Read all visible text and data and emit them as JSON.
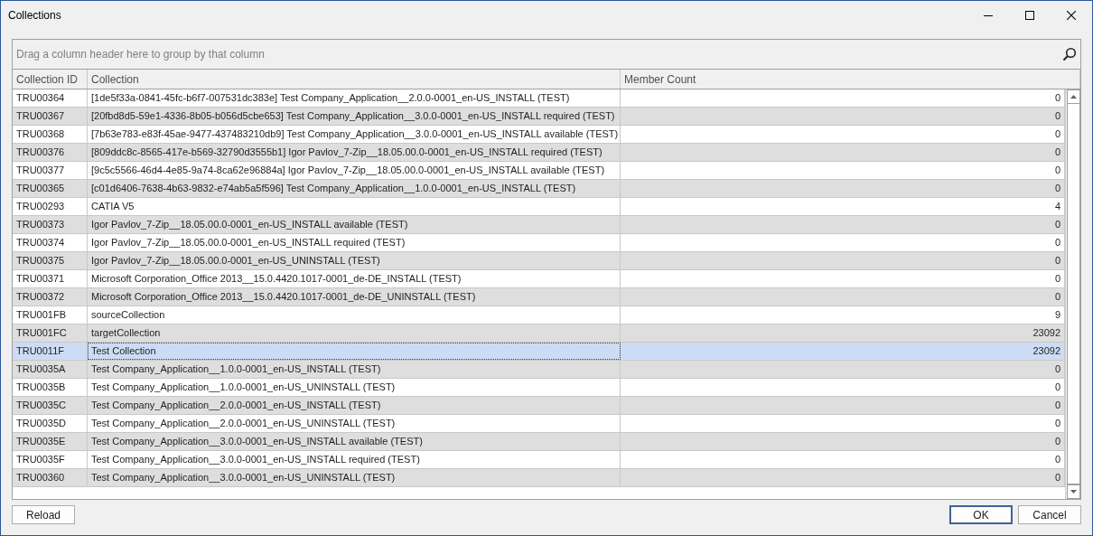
{
  "window": {
    "title": "Collections"
  },
  "group_panel": {
    "hint": "Drag a column header here to group by that column"
  },
  "table": {
    "columns": [
      "Collection ID",
      "Collection",
      "Member Count"
    ],
    "rows": [
      {
        "id": "TRU00364",
        "collection": "[1de5f33a-0841-45fc-b6f7-007531dc383e] Test Company_Application__2.0.0-0001_en-US_INSTALL (TEST)",
        "member_count": "0",
        "selected": false
      },
      {
        "id": "TRU00367",
        "collection": "[20fbd8d5-59e1-4336-8b05-b056d5cbe653] Test Company_Application__3.0.0-0001_en-US_INSTALL required (TEST)",
        "member_count": "0",
        "selected": false
      },
      {
        "id": "TRU00368",
        "collection": "[7b63e783-e83f-45ae-9477-437483210db9] Test Company_Application__3.0.0-0001_en-US_INSTALL available (TEST)",
        "member_count": "0",
        "selected": false
      },
      {
        "id": "TRU00376",
        "collection": "[809ddc8c-8565-417e-b569-32790d3555b1] Igor Pavlov_7-Zip__18.05.00.0-0001_en-US_INSTALL required (TEST)",
        "member_count": "0",
        "selected": false
      },
      {
        "id": "TRU00377",
        "collection": "[9c5c5566-46d4-4e85-9a74-8ca62e96884a] Igor Pavlov_7-Zip__18.05.00.0-0001_en-US_INSTALL available (TEST)",
        "member_count": "0",
        "selected": false
      },
      {
        "id": "TRU00365",
        "collection": "[c01d6406-7638-4b63-9832-e74ab5a5f596] Test Company_Application__1.0.0-0001_en-US_INSTALL (TEST)",
        "member_count": "0",
        "selected": false
      },
      {
        "id": "TRU00293",
        "collection": "CATIA V5",
        "member_count": "4",
        "selected": false
      },
      {
        "id": "TRU00373",
        "collection": "Igor Pavlov_7-Zip__18.05.00.0-0001_en-US_INSTALL available (TEST)",
        "member_count": "0",
        "selected": false
      },
      {
        "id": "TRU00374",
        "collection": "Igor Pavlov_7-Zip__18.05.00.0-0001_en-US_INSTALL required (TEST)",
        "member_count": "0",
        "selected": false
      },
      {
        "id": "TRU00375",
        "collection": "Igor Pavlov_7-Zip__18.05.00.0-0001_en-US_UNINSTALL (TEST)",
        "member_count": "0",
        "selected": false
      },
      {
        "id": "TRU00371",
        "collection": "Microsoft Corporation_Office 2013__15.0.4420.1017-0001_de-DE_INSTALL (TEST)",
        "member_count": "0",
        "selected": false
      },
      {
        "id": "TRU00372",
        "collection": "Microsoft Corporation_Office 2013__15.0.4420.1017-0001_de-DE_UNINSTALL (TEST)",
        "member_count": "0",
        "selected": false
      },
      {
        "id": "TRU001FB",
        "collection": "sourceCollection",
        "member_count": "9",
        "selected": false
      },
      {
        "id": "TRU001FC",
        "collection": "targetCollection",
        "member_count": "23092",
        "selected": false
      },
      {
        "id": "TRU0011F",
        "collection": "Test Collection",
        "member_count": "23092",
        "selected": true
      },
      {
        "id": "TRU0035A",
        "collection": "Test Company_Application__1.0.0-0001_en-US_INSTALL (TEST)",
        "member_count": "0",
        "selected": false
      },
      {
        "id": "TRU0035B",
        "collection": "Test Company_Application__1.0.0-0001_en-US_UNINSTALL (TEST)",
        "member_count": "0",
        "selected": false
      },
      {
        "id": "TRU0035C",
        "collection": "Test Company_Application__2.0.0-0001_en-US_INSTALL (TEST)",
        "member_count": "0",
        "selected": false
      },
      {
        "id": "TRU0035D",
        "collection": "Test Company_Application__2.0.0-0001_en-US_UNINSTALL (TEST)",
        "member_count": "0",
        "selected": false
      },
      {
        "id": "TRU0035E",
        "collection": "Test Company_Application__3.0.0-0001_en-US_INSTALL available (TEST)",
        "member_count": "0",
        "selected": false
      },
      {
        "id": "TRU0035F",
        "collection": "Test Company_Application__3.0.0-0001_en-US_INSTALL required (TEST)",
        "member_count": "0",
        "selected": false
      },
      {
        "id": "TRU00360",
        "collection": "Test Company_Application__3.0.0-0001_en-US_UNINSTALL (TEST)",
        "member_count": "0",
        "selected": false
      }
    ]
  },
  "buttons": {
    "left": [
      "Reload"
    ],
    "right": [
      {
        "label": "OK",
        "default": true
      },
      {
        "label": "Cancel",
        "default": false
      }
    ]
  }
}
